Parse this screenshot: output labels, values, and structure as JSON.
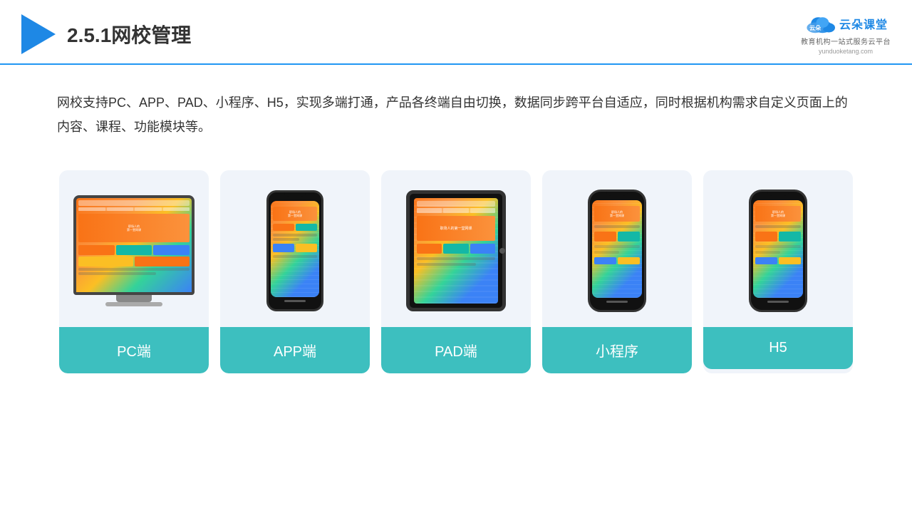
{
  "header": {
    "title": "2.5.1网校管理",
    "brand_name": "云朵课堂",
    "brand_url": "yunduoketang.com",
    "brand_tagline": "教育机构一站式服务云平台"
  },
  "description": {
    "text": "网校支持PC、APP、PAD、小程序、H5，实现多端打通，产品各终端自由切换，数据同步跨平台自适应，同时根据机构需求自定义页面上的内容、课程、功能模块等。"
  },
  "cards": [
    {
      "label": "PC端",
      "type": "pc"
    },
    {
      "label": "APP端",
      "type": "phone"
    },
    {
      "label": "PAD端",
      "type": "tablet"
    },
    {
      "label": "小程序",
      "type": "phone"
    },
    {
      "label": "H5",
      "type": "phone"
    }
  ]
}
